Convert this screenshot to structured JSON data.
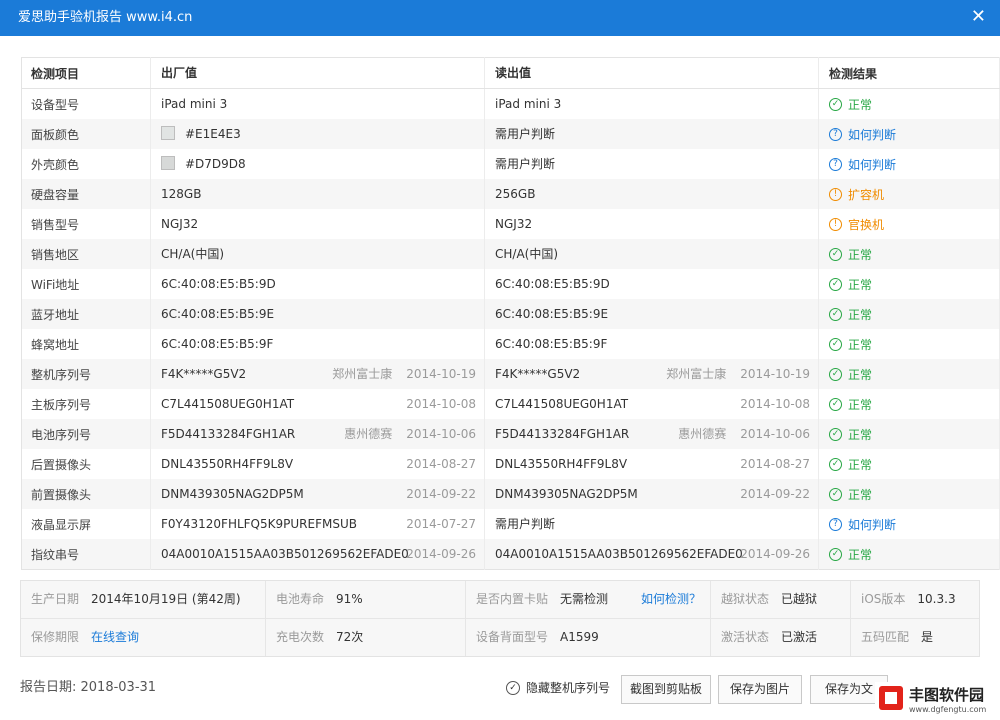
{
  "window": {
    "title": "爱思助手验机报告 www.i4.cn",
    "close_glyph": "✕"
  },
  "table": {
    "headers": [
      "检测项目",
      "出厂值",
      "读出值",
      "检测结果"
    ],
    "rows": [
      {
        "item": "设备型号",
        "factory": "iPad mini 3",
        "read": "iPad mini 3",
        "result": "正常",
        "status": "ok"
      },
      {
        "item": "面板颜色",
        "factory": "#E1E4E3",
        "read": "需用户判断",
        "result": "如何判断",
        "status": "help"
      },
      {
        "item": "外壳颜色",
        "factory": "#D7D9D8",
        "read": "需用户判断",
        "result": "如何判断",
        "status": "help"
      },
      {
        "item": "硬盘容量",
        "factory": "128GB",
        "read": "256GB",
        "result": "扩容机",
        "status": "warn"
      },
      {
        "item": "销售型号",
        "factory": "NGJ32",
        "read": "NGJ32",
        "result": "官换机",
        "status": "warn"
      },
      {
        "item": "销售地区",
        "factory": "CH/A(中国)",
        "read": "CH/A(中国)",
        "result": "正常",
        "status": "ok"
      },
      {
        "item": "WiFi地址",
        "factory": "6C:40:08:E5:B5:9D",
        "read": "6C:40:08:E5:B5:9D",
        "result": "正常",
        "status": "ok"
      },
      {
        "item": "蓝牙地址",
        "factory": "6C:40:08:E5:B5:9E",
        "read": "6C:40:08:E5:B5:9E",
        "result": "正常",
        "status": "ok"
      },
      {
        "item": "蜂窝地址",
        "factory": "6C:40:08:E5:B5:9F",
        "read": "6C:40:08:E5:B5:9F",
        "result": "正常",
        "status": "ok"
      },
      {
        "item": "整机序列号",
        "factory": "F4K*****G5V2",
        "factory_place": "郑州富士康",
        "factory_date": "2014-10-19",
        "read": "F4K*****G5V2",
        "read_place": "郑州富士康",
        "read_date": "2014-10-19",
        "result": "正常",
        "status": "ok"
      },
      {
        "item": "主板序列号",
        "factory": "C7L441508UEG0H1AT",
        "factory_date": "2014-10-08",
        "read": "C7L441508UEG0H1AT",
        "read_date": "2014-10-08",
        "result": "正常",
        "status": "ok"
      },
      {
        "item": "电池序列号",
        "factory": "F5D44133284FGH1AR",
        "factory_place": "惠州德赛",
        "factory_date": "2014-10-06",
        "read": "F5D44133284FGH1AR",
        "read_place": "惠州德赛",
        "read_date": "2014-10-06",
        "result": "正常",
        "status": "ok"
      },
      {
        "item": "后置摄像头",
        "factory": "DNL43550RH4FF9L8V",
        "factory_date": "2014-08-27",
        "read": "DNL43550RH4FF9L8V",
        "read_date": "2014-08-27",
        "result": "正常",
        "status": "ok"
      },
      {
        "item": "前置摄像头",
        "factory": "DNM439305NAG2DP5M",
        "factory_date": "2014-09-22",
        "read": "DNM439305NAG2DP5M",
        "read_date": "2014-09-22",
        "result": "正常",
        "status": "ok"
      },
      {
        "item": "液晶显示屏",
        "factory": "F0Y43120FHLFQ5K9PUREFMSUB",
        "factory_date": "2014-07-27",
        "read": "需用户判断",
        "result": "如何判断",
        "status": "help"
      },
      {
        "item": "指纹串号",
        "factory": "04A0010A1515AA03B501269562EFADE0",
        "factory_date": "2014-09-26",
        "read": "04A0010A1515AA03B501269562EFADE0",
        "read_date": "2014-09-26",
        "result": "正常",
        "status": "ok"
      }
    ]
  },
  "status_icons": {
    "ok": "✓",
    "help": "?",
    "warn": "!"
  },
  "status_colors": {
    "ok": "#28a745",
    "help": "#1b7bd8",
    "warn": "#f08c00"
  },
  "swatches": {
    "面板颜色": "#E1E4E3",
    "外壳颜色": "#D7D9D8"
  },
  "info": {
    "manufacture_date": {
      "label": "生产日期",
      "value": "2014年10月19日 (第42周)"
    },
    "battery_life": {
      "label": "电池寿命",
      "value": "91%"
    },
    "builtin_card": {
      "label": "是否内置卡贴",
      "value": "无需检测",
      "link": "如何检测？"
    },
    "jailbreak": {
      "label": "越狱状态",
      "value": "已越狱"
    },
    "ios_version": {
      "label": "iOS版本",
      "value": "10.3.3"
    },
    "warranty": {
      "label": "保修期限",
      "link": "在线查询"
    },
    "charge_count": {
      "label": "充电次数",
      "value": "72次"
    },
    "back_model": {
      "label": "设备背面型号",
      "value": "A1599"
    },
    "activation": {
      "label": "激活状态",
      "value": "已激活"
    },
    "five_code": {
      "label": "五码匹配",
      "value": "是"
    }
  },
  "footer": {
    "report_date": "报告日期: 2018-03-31",
    "hide_serial_label": "隐藏整机序列号",
    "check_glyph": "✓",
    "copy_button": "截图到剪贴板",
    "save_image_button": "保存为图片",
    "save_file_button": "保存为文"
  },
  "watermark": {
    "title": "丰图软件园",
    "url": "www.dgfengtu.com"
  }
}
